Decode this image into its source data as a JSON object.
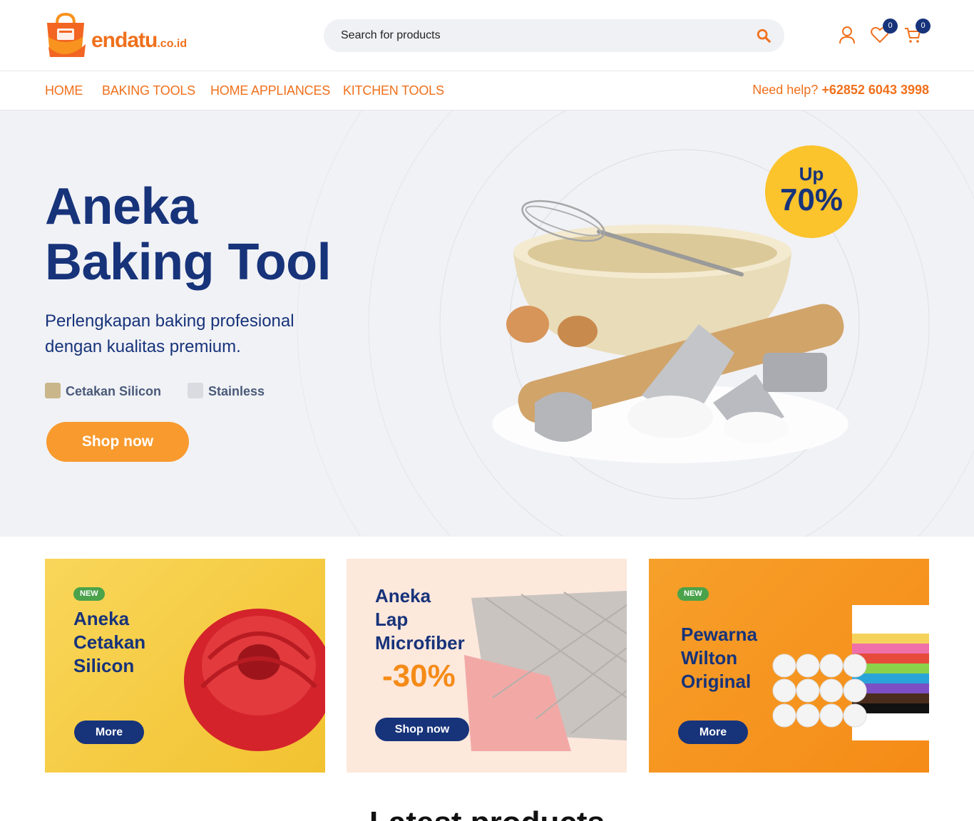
{
  "header": {
    "logo_text": "endatu",
    "logo_suffix": ".co.id",
    "search_placeholder": "Search for products",
    "wishlist_count": "0",
    "cart_count": "0"
  },
  "nav": {
    "items": [
      "HOME",
      "BAKING TOOLS",
      "HOME APPLIANCES",
      "KITCHEN TOOLS"
    ],
    "help_label": "Need help?",
    "help_phone": "+62852 6043 3998"
  },
  "hero": {
    "title_line1": "Aneka",
    "title_line2": "Baking Tool",
    "subtitle": "Perlengkapan baking profesional dengan kualitas premium.",
    "feature1": "Cetakan Silicon",
    "feature2": "Stainless",
    "cta": "Shop now",
    "promo_line1": "Up",
    "promo_line2": "70%"
  },
  "banners": [
    {
      "tag": "NEW",
      "title": [
        "Aneka",
        "Cetakan",
        "Silicon"
      ],
      "button": "More"
    },
    {
      "title": [
        "Aneka",
        "Lap",
        "Microfiber"
      ],
      "discount": "-30%",
      "button": "Shop now"
    },
    {
      "tag": "NEW",
      "title": [
        "Pewarna",
        "Wilton",
        "Original"
      ],
      "button": "More"
    }
  ],
  "section_title": "Latest products",
  "colors": {
    "brand_orange": "#f0701c",
    "navy": "#17337a",
    "cta_orange": "#f89a2e",
    "promo_yellow": "#fbc32c",
    "new_green": "#4aa24a"
  }
}
